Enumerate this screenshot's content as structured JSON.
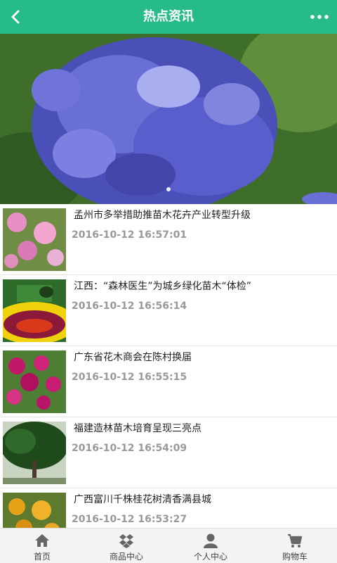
{
  "header": {
    "title": "热点资讯",
    "back_icon": "chevron-left-icon",
    "more_icon": "more-dots-icon"
  },
  "banner": {
    "slides": 1,
    "active_index": 0
  },
  "news": [
    {
      "title": "孟州市多举措助推苗木花卉产业转型升级",
      "time": "2016-10-12 16:57:01"
    },
    {
      "title": "江西：“森林医生”为城乡绿化苗木“体检”",
      "time": "2016-10-12 16:56:14"
    },
    {
      "title": "广东省花木商会在陈村换届",
      "time": "2016-10-12 16:55:15"
    },
    {
      "title": "福建造林苗木培育呈现三亮点",
      "time": "2016-10-12 16:54:09"
    },
    {
      "title": "广西富川千株桂花树清香满县城",
      "time": "2016-10-12 16:53:27"
    }
  ],
  "tabbar": [
    {
      "label": "首页",
      "icon": "home-icon"
    },
    {
      "label": "商品中心",
      "icon": "dropbox-icon"
    },
    {
      "label": "个人中心",
      "icon": "user-icon"
    },
    {
      "label": "购物车",
      "icon": "cart-icon"
    }
  ],
  "colors": {
    "accent": "#27bb8a"
  }
}
